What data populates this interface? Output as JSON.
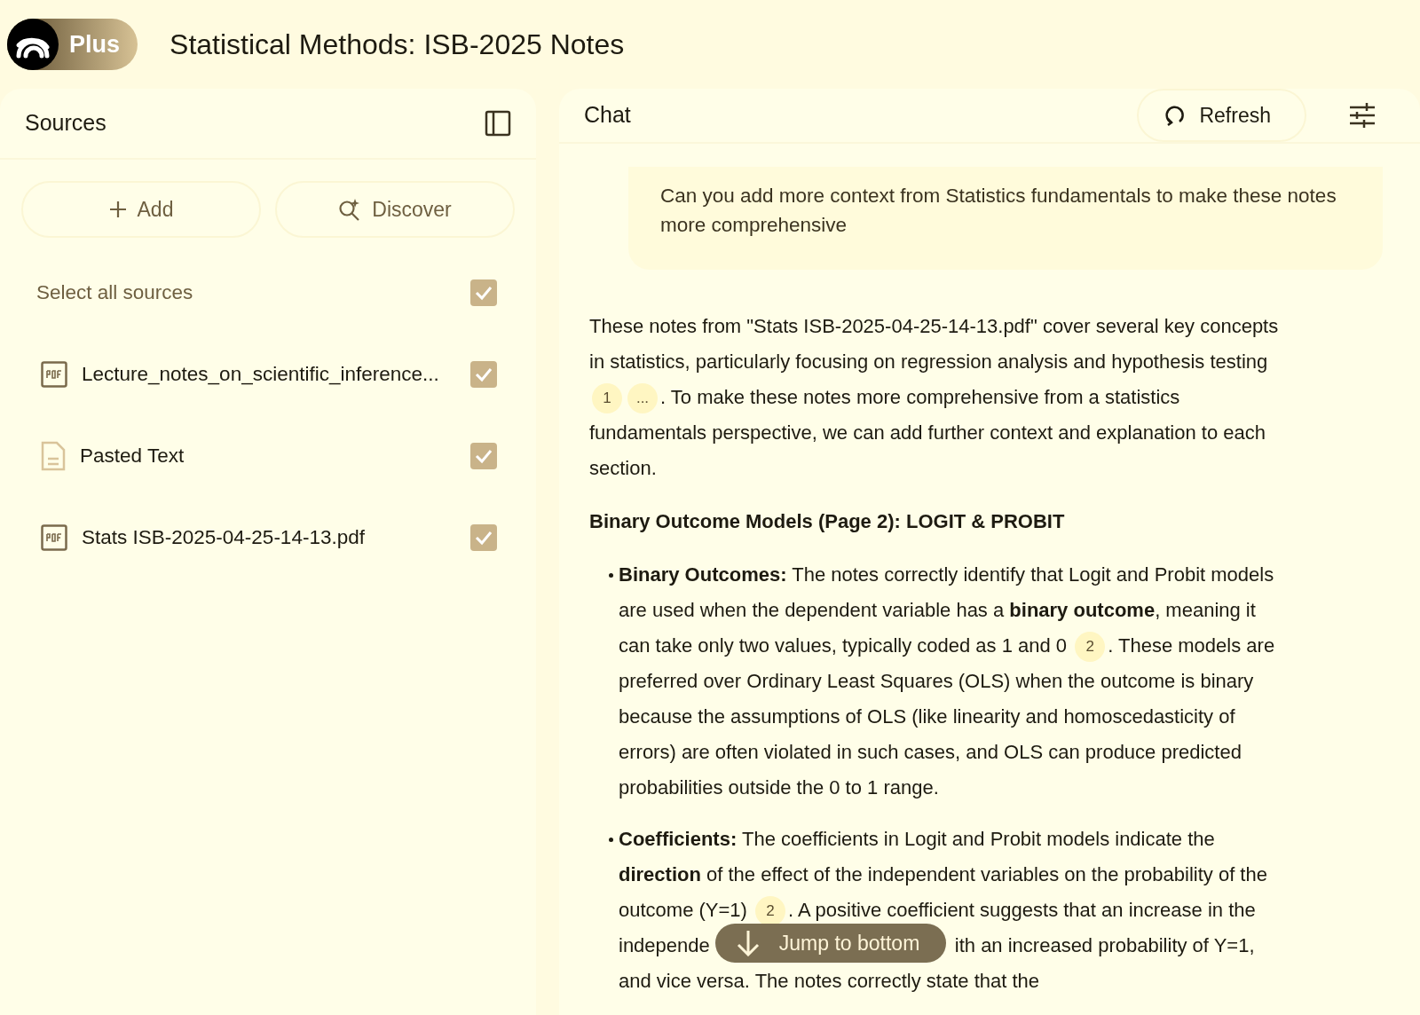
{
  "app": {
    "badge": "Plus",
    "title": "Statistical Methods: ISB-2025 Notes"
  },
  "sources": {
    "title": "Sources",
    "buttons": [
      {
        "label": "Add",
        "kind": "add"
      },
      {
        "label": "Discover",
        "kind": "discover"
      }
    ],
    "select_all": {
      "label": "Select all sources",
      "checked": true
    },
    "items": [
      {
        "name": "Lecture_notes_on_scientific_inference...",
        "kind": "pdf",
        "checked": true
      },
      {
        "name": "Pasted Text",
        "kind": "text",
        "checked": true
      },
      {
        "name": "Stats ISB-2025-04-25-14-13.pdf",
        "kind": "pdf",
        "checked": true
      }
    ]
  },
  "chat": {
    "title": "Chat",
    "refresh": "Refresh",
    "question": "Can you add more context from Statistics fundamentals to make these notes more comprehensive",
    "jump": "Jump to bottom",
    "answer": [
      {
        "kind": "paragraph",
        "parts": [
          {
            "kind": "text",
            "text": "These notes from \"Stats ISB-2025-04-25-14-13.pdf\" cover several key concepts in statistics, particularly focusing on regression analysis and hypothesis testing "
          },
          {
            "kind": "cite",
            "text": "1"
          },
          {
            "kind": "cite",
            "text": "..."
          },
          {
            "kind": "text",
            "text": ". To make these notes more comprehensive from a statistics fundamentals perspective, we can add further context and explanation to each section."
          }
        ]
      },
      {
        "kind": "heading",
        "parts": [
          {
            "kind": "text",
            "text": "Binary Outcome Models (Page 2): LOGIT & PROBIT"
          }
        ]
      },
      {
        "kind": "bullet",
        "parts": [
          {
            "kind": "text",
            "text": "**Binary Outcomes:** The notes correctly identify that Logit and Probit models are used when the dependent variable has a **binary outcome**, meaning it can take only two values, typically coded as 1 and 0 "
          },
          {
            "kind": "cite",
            "text": "2"
          },
          {
            "kind": "text",
            "text": ". These models are preferred over Ordinary Least Squares (OLS) when the outcome is binary because the assumptions of OLS (like linearity and homoscedasticity of errors) are often violated in such cases, and OLS can produce predicted probabilities outside the 0 to 1 range."
          }
        ]
      },
      {
        "kind": "bullet",
        "parts": [
          {
            "kind": "text",
            "text": "**Coefficients:** The coefficients in Logit and Probit models indicate the **direction** of the effect of the independent variables on the probability of the outcome (Y=1) "
          },
          {
            "kind": "cite",
            "text": "2"
          },
          {
            "kind": "text",
            "text": ". A positive coefficient suggests that an increase in the independe"
          },
          {
            "kind": "covered"
          },
          {
            "kind": "text",
            "text": "ith an increased probability of Y=1, and vice versa. The notes correctly state that the"
          }
        ]
      }
    ]
  }
}
